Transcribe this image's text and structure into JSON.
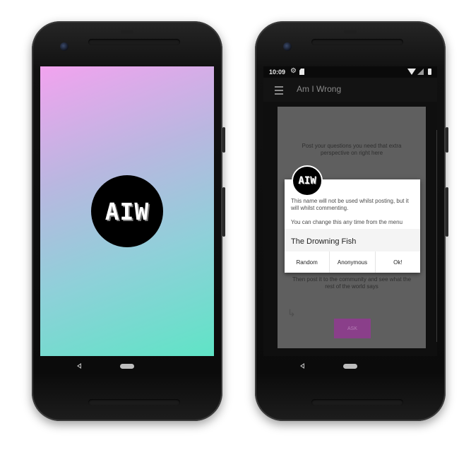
{
  "splash": {
    "logo_text": "AIW"
  },
  "status_bar": {
    "time": "10:09",
    "icons": [
      "gear-icon",
      "sd-card-icon",
      "wifi-icon",
      "signal-icon",
      "battery-icon"
    ]
  },
  "app_bar": {
    "menu_icon": "hamburger-icon",
    "title": "Am I Wrong"
  },
  "card": {
    "intro_text": "Post your questions you need that extra perspective on right here",
    "footer_text": "Then post it to the community and see what the rest of the world says",
    "ask_label": "ASK"
  },
  "dialog": {
    "logo_text": "AIW",
    "message": "This name will not be used whilst posting, but it will whilst commenting.",
    "hint": "You can change this any time from the menu",
    "name_value": "The Drowning Fish",
    "buttons": {
      "random": "Random",
      "anonymous": "Anonymous",
      "ok": "Ok!"
    }
  },
  "colors": {
    "splash_gradient": [
      "#f2a3ef",
      "#5fe4c6"
    ],
    "ask_button": "#8a3f8a",
    "dialog_bg": "#ffffff"
  }
}
